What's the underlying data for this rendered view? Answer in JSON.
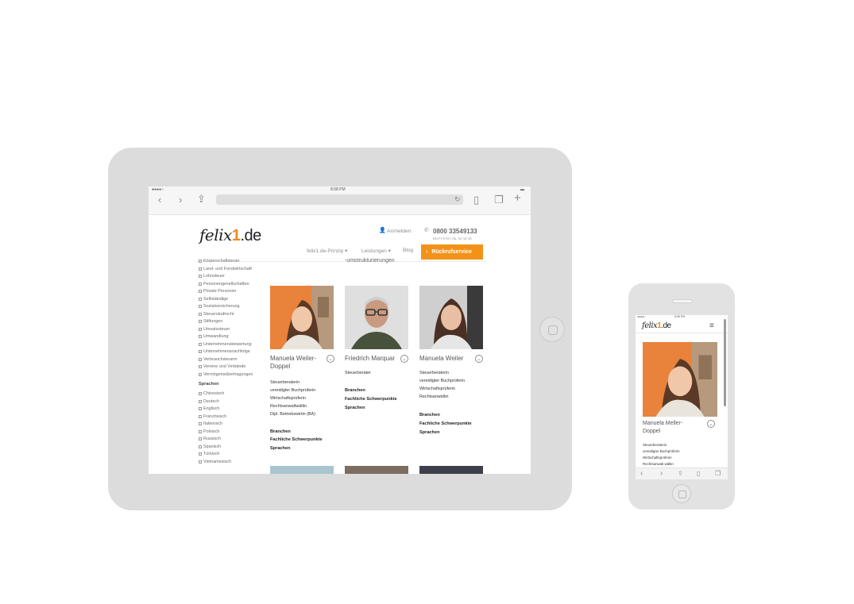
{
  "tablet": {
    "status": {
      "carrier": "●●●●○",
      "time": "8:08 PM",
      "battery": "▬"
    },
    "header": {
      "logo": {
        "text": "felix",
        "one": "1",
        "de": ".de"
      },
      "login_label": "Anmelden",
      "phone_number": "0800 33549133",
      "hours": "Mo-Fr 8-19 | Sa, So 12-16",
      "nav": [
        "felix1.de-Prinzip ▾",
        "Leistungen ▾",
        "Blog"
      ],
      "cta": "Rückrufservice"
    },
    "partial_line": "-umstrukturierungen",
    "sidebar": {
      "group1_items": [
        "Körperschaftsteuer",
        "Land- und Forstwirtschaft",
        "Lohnsteuer",
        "Personengesellschaften",
        "Private Personen",
        "Selbständige",
        "Sozialversicherung",
        "Steuerstrafrecht",
        "Stiftungen",
        "Umsatzsteuer",
        "Umwandlung",
        "Unternehmensbewertung",
        "Unternehmensnachfolge",
        "Verbrauchsteuern",
        "Vereine und Verbände",
        "Vermögensübertragungen"
      ],
      "group2_heading": "Sprachen",
      "group2_items": [
        "Chinesisch",
        "Deutsch",
        "Englisch",
        "Französisch",
        "Italienisch",
        "Polnisch",
        "Russisch",
        "Spanisch",
        "Türkisch",
        "Vietnamesisch"
      ]
    },
    "persons": [
      {
        "name_line1": "Manuela Weiler-",
        "name_line2": "Doppel",
        "roles": [
          "Steuerberaterin",
          "vereidigter Buchprüferin",
          "Wirtschaftsprüferin",
          "Rechtsanwaltwältin",
          "Dipl. Betriebswirtin (BA)"
        ],
        "links": [
          "Branchen",
          "Fachliche Schwerpunkte",
          "Sprachen"
        ]
      },
      {
        "name_line1": "Friedrich Marquar",
        "name_line2": "",
        "roles": [
          "Steuerberater"
        ],
        "links": [
          "Branchen",
          "Fachliche Schwerpunkte",
          "Sprachen"
        ]
      },
      {
        "name_line1": "Manuela Weiler",
        "name_line2": "",
        "roles": [
          "Steuerberaterin",
          "vereidigter Buchprüferin",
          "Wirtschaftsprüferin",
          "Rechtsanwältin"
        ],
        "links": [
          "Branchen",
          "Fachliche Schwerpunkte",
          "Sprachen"
        ]
      }
    ]
  },
  "phone": {
    "status": {
      "carrier": "●●●●○",
      "time": "8:08 PM"
    },
    "logo": {
      "text": "felix",
      "one": "1",
      "de": ".de"
    },
    "person": {
      "name_line1": "Manuela Meller-",
      "name_line2": "Doppel",
      "roles": [
        "Steuerberaterin",
        "vereidigter Buchprüferin",
        "Wirtschaftsprüferin",
        "Rechtsanwalt wältin"
      ]
    }
  },
  "colors": {
    "accent": "#f39218",
    "device": "#dcdcdc"
  }
}
